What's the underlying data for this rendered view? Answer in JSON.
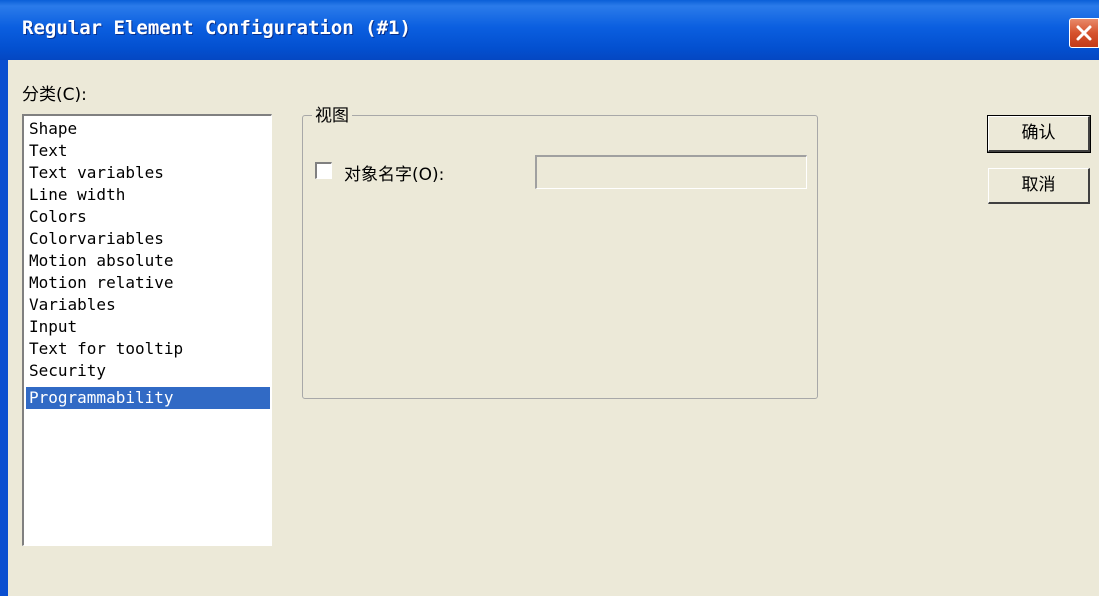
{
  "window": {
    "title": "Regular Element Configuration (#1)"
  },
  "category": {
    "label": "分类(C):",
    "items": [
      {
        "label": "Shape"
      },
      {
        "label": "Text"
      },
      {
        "label": "Text variables"
      },
      {
        "label": "Line width"
      },
      {
        "label": "Colors"
      },
      {
        "label": "Colorvariables"
      },
      {
        "label": "Motion absolute"
      },
      {
        "label": "Motion relative"
      },
      {
        "label": "Variables"
      },
      {
        "label": "Input"
      },
      {
        "label": "Text for tooltip"
      },
      {
        "label": "Security"
      },
      {
        "label": "Programmability"
      }
    ],
    "selected": "Programmability"
  },
  "view": {
    "title": "视图",
    "object_name_label": "对象名字(O):",
    "object_name_checked": false,
    "object_name_value": ""
  },
  "buttons": {
    "ok": "确认",
    "cancel": "取消"
  },
  "icons": {
    "close": "close-icon"
  },
  "colors": {
    "titlebar": "#0350d0",
    "selection": "#316ac5",
    "dialog_bg": "#ece9d8"
  }
}
